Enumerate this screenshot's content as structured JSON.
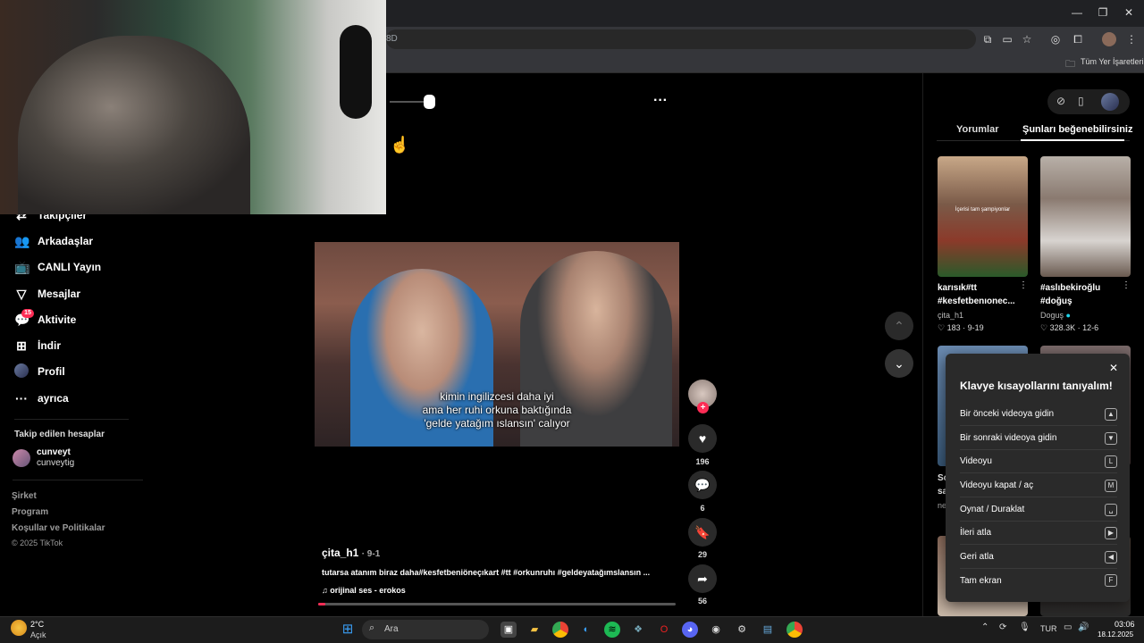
{
  "browser": {
    "url_fragment": "8D",
    "bookmarks_label": "Tüm Yer İşaretleri"
  },
  "sidebar": {
    "items": [
      {
        "label": "Takipçiler",
        "icon": "followers-icon"
      },
      {
        "label": "Arkadaşlar",
        "icon": "friends-icon"
      },
      {
        "label": "CANLI Yayın",
        "icon": "live-icon"
      },
      {
        "label": "Mesajlar",
        "icon": "messages-icon"
      },
      {
        "label": "Aktivite",
        "icon": "activity-icon",
        "badge": "15"
      },
      {
        "label": "İndir",
        "icon": "download-icon"
      },
      {
        "label": "Profil",
        "icon": "profile-icon"
      },
      {
        "label": "ayrıca",
        "icon": "more-icon"
      }
    ],
    "following_title": "Takip edilen hesaplar",
    "following": [
      {
        "name": "cunveyt",
        "handle": "cunveytig"
      }
    ],
    "footer": [
      "Şirket",
      "Program",
      "Koşullar ve Politikalar",
      "© 2025 TikTok"
    ]
  },
  "video": {
    "caption_lines": [
      "kimin ingilizcesi daha iyi",
      "ama her ruhi orkuna baktığında",
      "'gelde yatağım ıslansın' calıyor"
    ],
    "author": "çita_h1",
    "date": "· 9-1",
    "description": "tutarsa atanım biraz daha#kesfetbeniöneçıkart #tt #orkunruhı #geldeyatağımslansın ...",
    "music": "orijinal ses - erokos",
    "likes": "196",
    "comments": "6",
    "saves": "29",
    "shares": "56"
  },
  "right_panel": {
    "tabs": [
      "Yorumlar",
      "Şunları beğenebilirsiniz"
    ],
    "cards": [
      {
        "title_line1": "karısık#tt",
        "title_line2": "#kesfetbenıonec...",
        "author": "çita_h1",
        "likes": "183",
        "date": "9-19",
        "overlay": "İçerisi tam şampiyonlar"
      },
      {
        "title_line1": "#aslıbekiroğlu",
        "title_line2": "#doğuş",
        "author": "Doguş",
        "likes": "328.3K",
        "date": "12-6"
      }
    ],
    "partial_texts": [
      "Sc",
      "sa",
      "ne"
    ]
  },
  "shortcuts": {
    "title": "Klavye kısayollarını tanıyalım!",
    "rows": [
      {
        "label": "Bir önceki videoya gidin",
        "key": "▲"
      },
      {
        "label": "Bir sonraki videoya gidin",
        "key": "▼"
      },
      {
        "label": "Videoyu",
        "key": "L"
      },
      {
        "label": "Videoyu kapat / aç",
        "key": "M"
      },
      {
        "label": "Oynat / Duraklat",
        "key": "␣"
      },
      {
        "label": "İleri atla",
        "key": "▶"
      },
      {
        "label": "Geri atla",
        "key": "◀"
      },
      {
        "label": "Tam ekran",
        "key": "F"
      }
    ]
  },
  "taskbar": {
    "weather_temp": "2°C",
    "weather_desc": "Açık",
    "search_placeholder": "Ara",
    "lang": "TUR",
    "time": "03:06",
    "date": "18.12.2025"
  },
  "colors": {
    "accent": "#fe2c55",
    "panel": "#2a2a2a"
  }
}
